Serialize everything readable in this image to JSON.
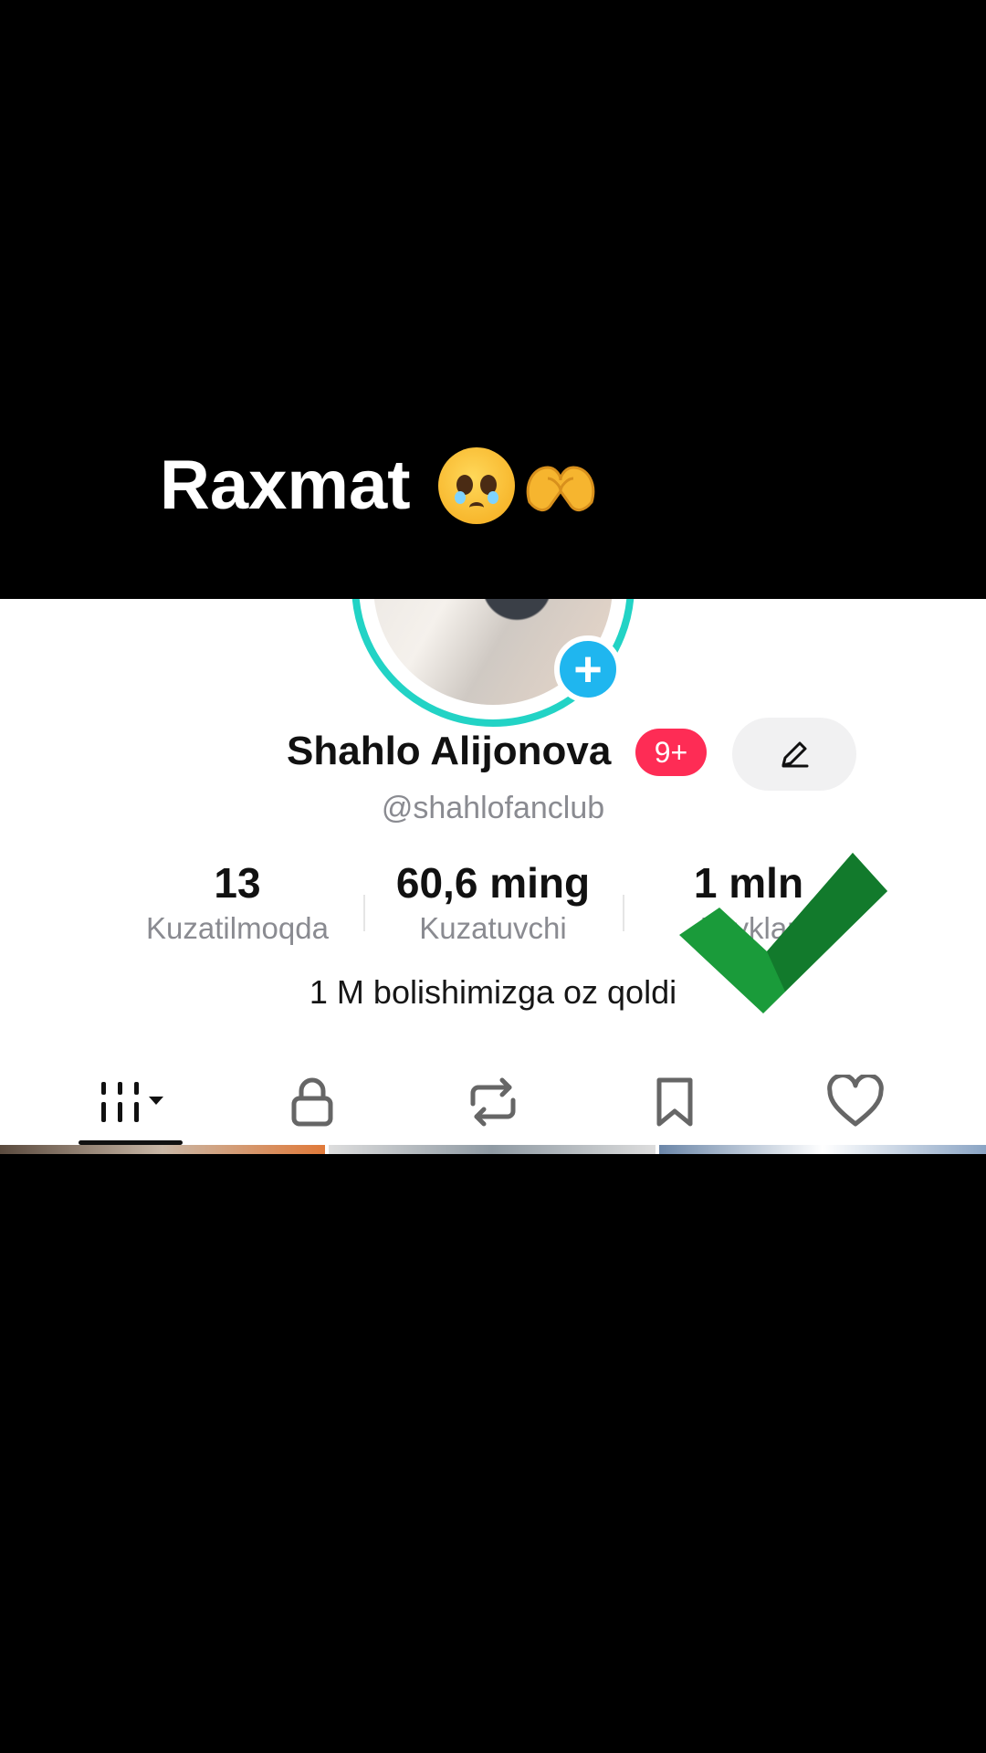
{
  "caption": {
    "text": "Raxmat"
  },
  "profile": {
    "name": "Shahlo Alijonova",
    "notification_badge": "9+",
    "handle": "@shahlofanclub",
    "bio": "1 M bolishimizga oz qoldi"
  },
  "stats": [
    {
      "value": "13",
      "label": "Kuzatilmoqda"
    },
    {
      "value": "60,6 ming",
      "label": "Kuzatuvchi"
    },
    {
      "value": "1 mln",
      "label": "Layklar"
    }
  ],
  "tabs": [
    {
      "icon": "videos-grid-icon"
    },
    {
      "icon": "lock-icon"
    },
    {
      "icon": "repost-icon"
    },
    {
      "icon": "bookmark-icon"
    },
    {
      "icon": "heart-icon"
    }
  ],
  "colors": {
    "accent_ring": "#22d3c5",
    "plus_badge": "#1fb6ef",
    "notif_badge": "#fe2c55",
    "checkmark": "#1a9b3a"
  }
}
